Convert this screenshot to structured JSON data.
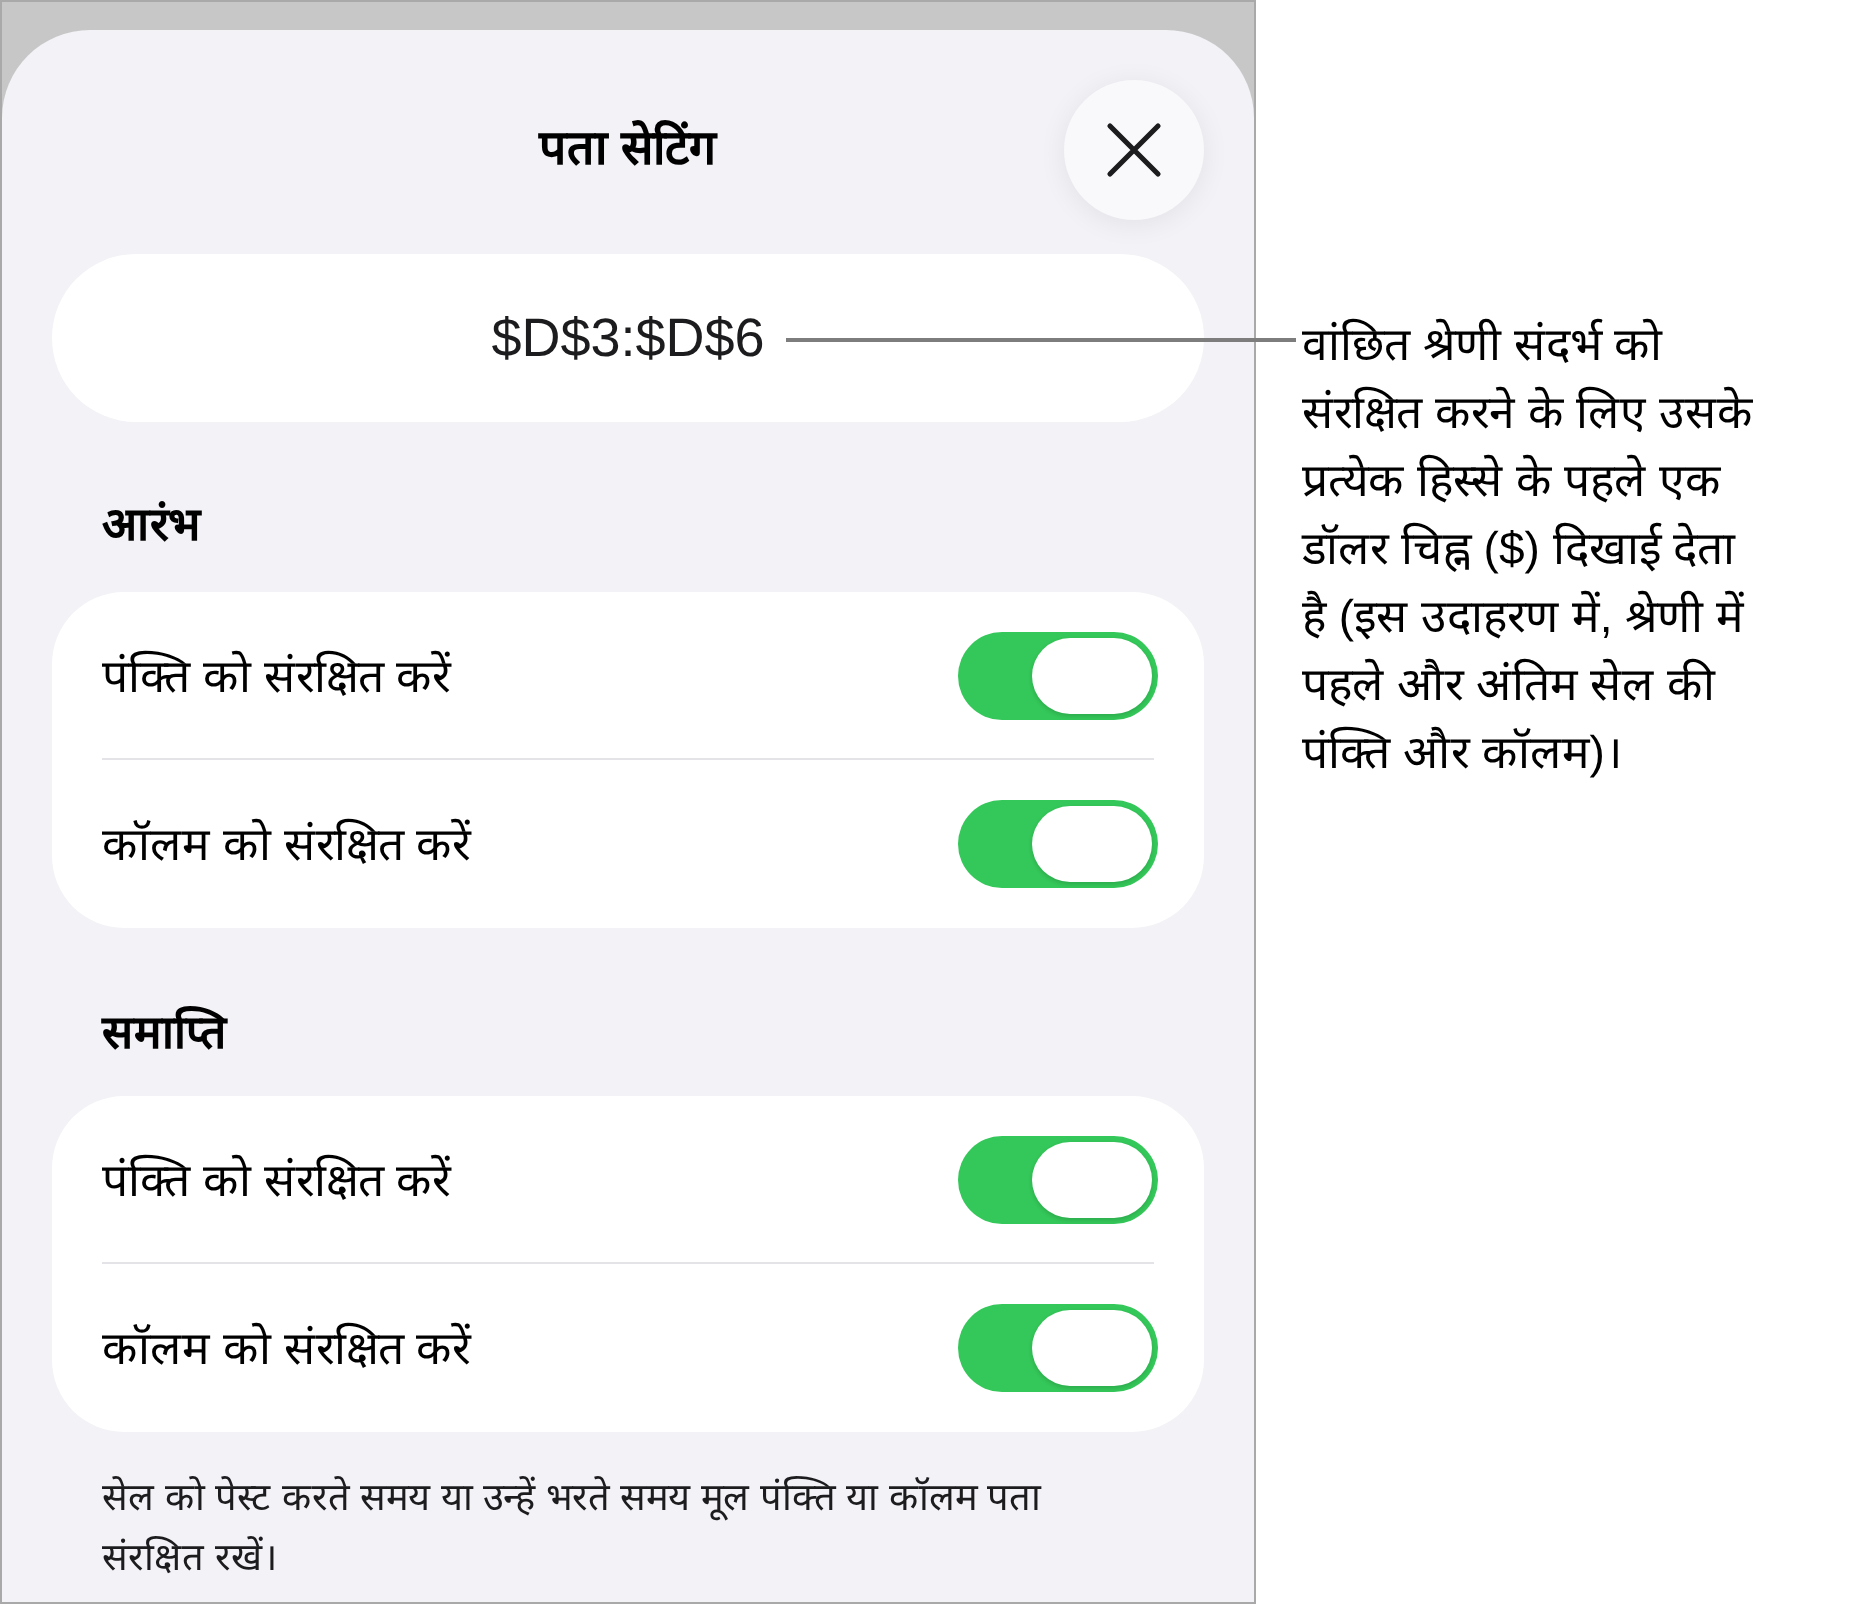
{
  "sheet": {
    "title": "पता सेटिंग",
    "address": "$D$3:$D$6",
    "sections": [
      {
        "header": "आरंभ",
        "rows": [
          {
            "label": "पंक्ति को संरक्षित करें",
            "on": true
          },
          {
            "label": "कॉलम को संरक्षित करें",
            "on": true
          }
        ]
      },
      {
        "header": "समाप्ति",
        "rows": [
          {
            "label": "पंक्ति को संरक्षित करें",
            "on": true
          },
          {
            "label": "कॉलम को संरक्षित करें",
            "on": true
          }
        ]
      }
    ],
    "footnote": "सेल को पेस्ट करते समय या उन्हें भरते समय मूल पंक्ति या कॉलम पता संरक्षित रखें।"
  },
  "callout": {
    "lines": [
      "वांछित श्रेणी संदर्भ को",
      "संरक्षित करने के लिए उसके",
      "प्रत्येक हिस्से के पहले एक",
      "डॉलर चिह्न ($) दिखाई देता",
      "है (इस उदाहरण में, श्रेणी में",
      "पहले और अंतिम सेल की",
      "पंक्ति और कॉलम)।"
    ]
  }
}
